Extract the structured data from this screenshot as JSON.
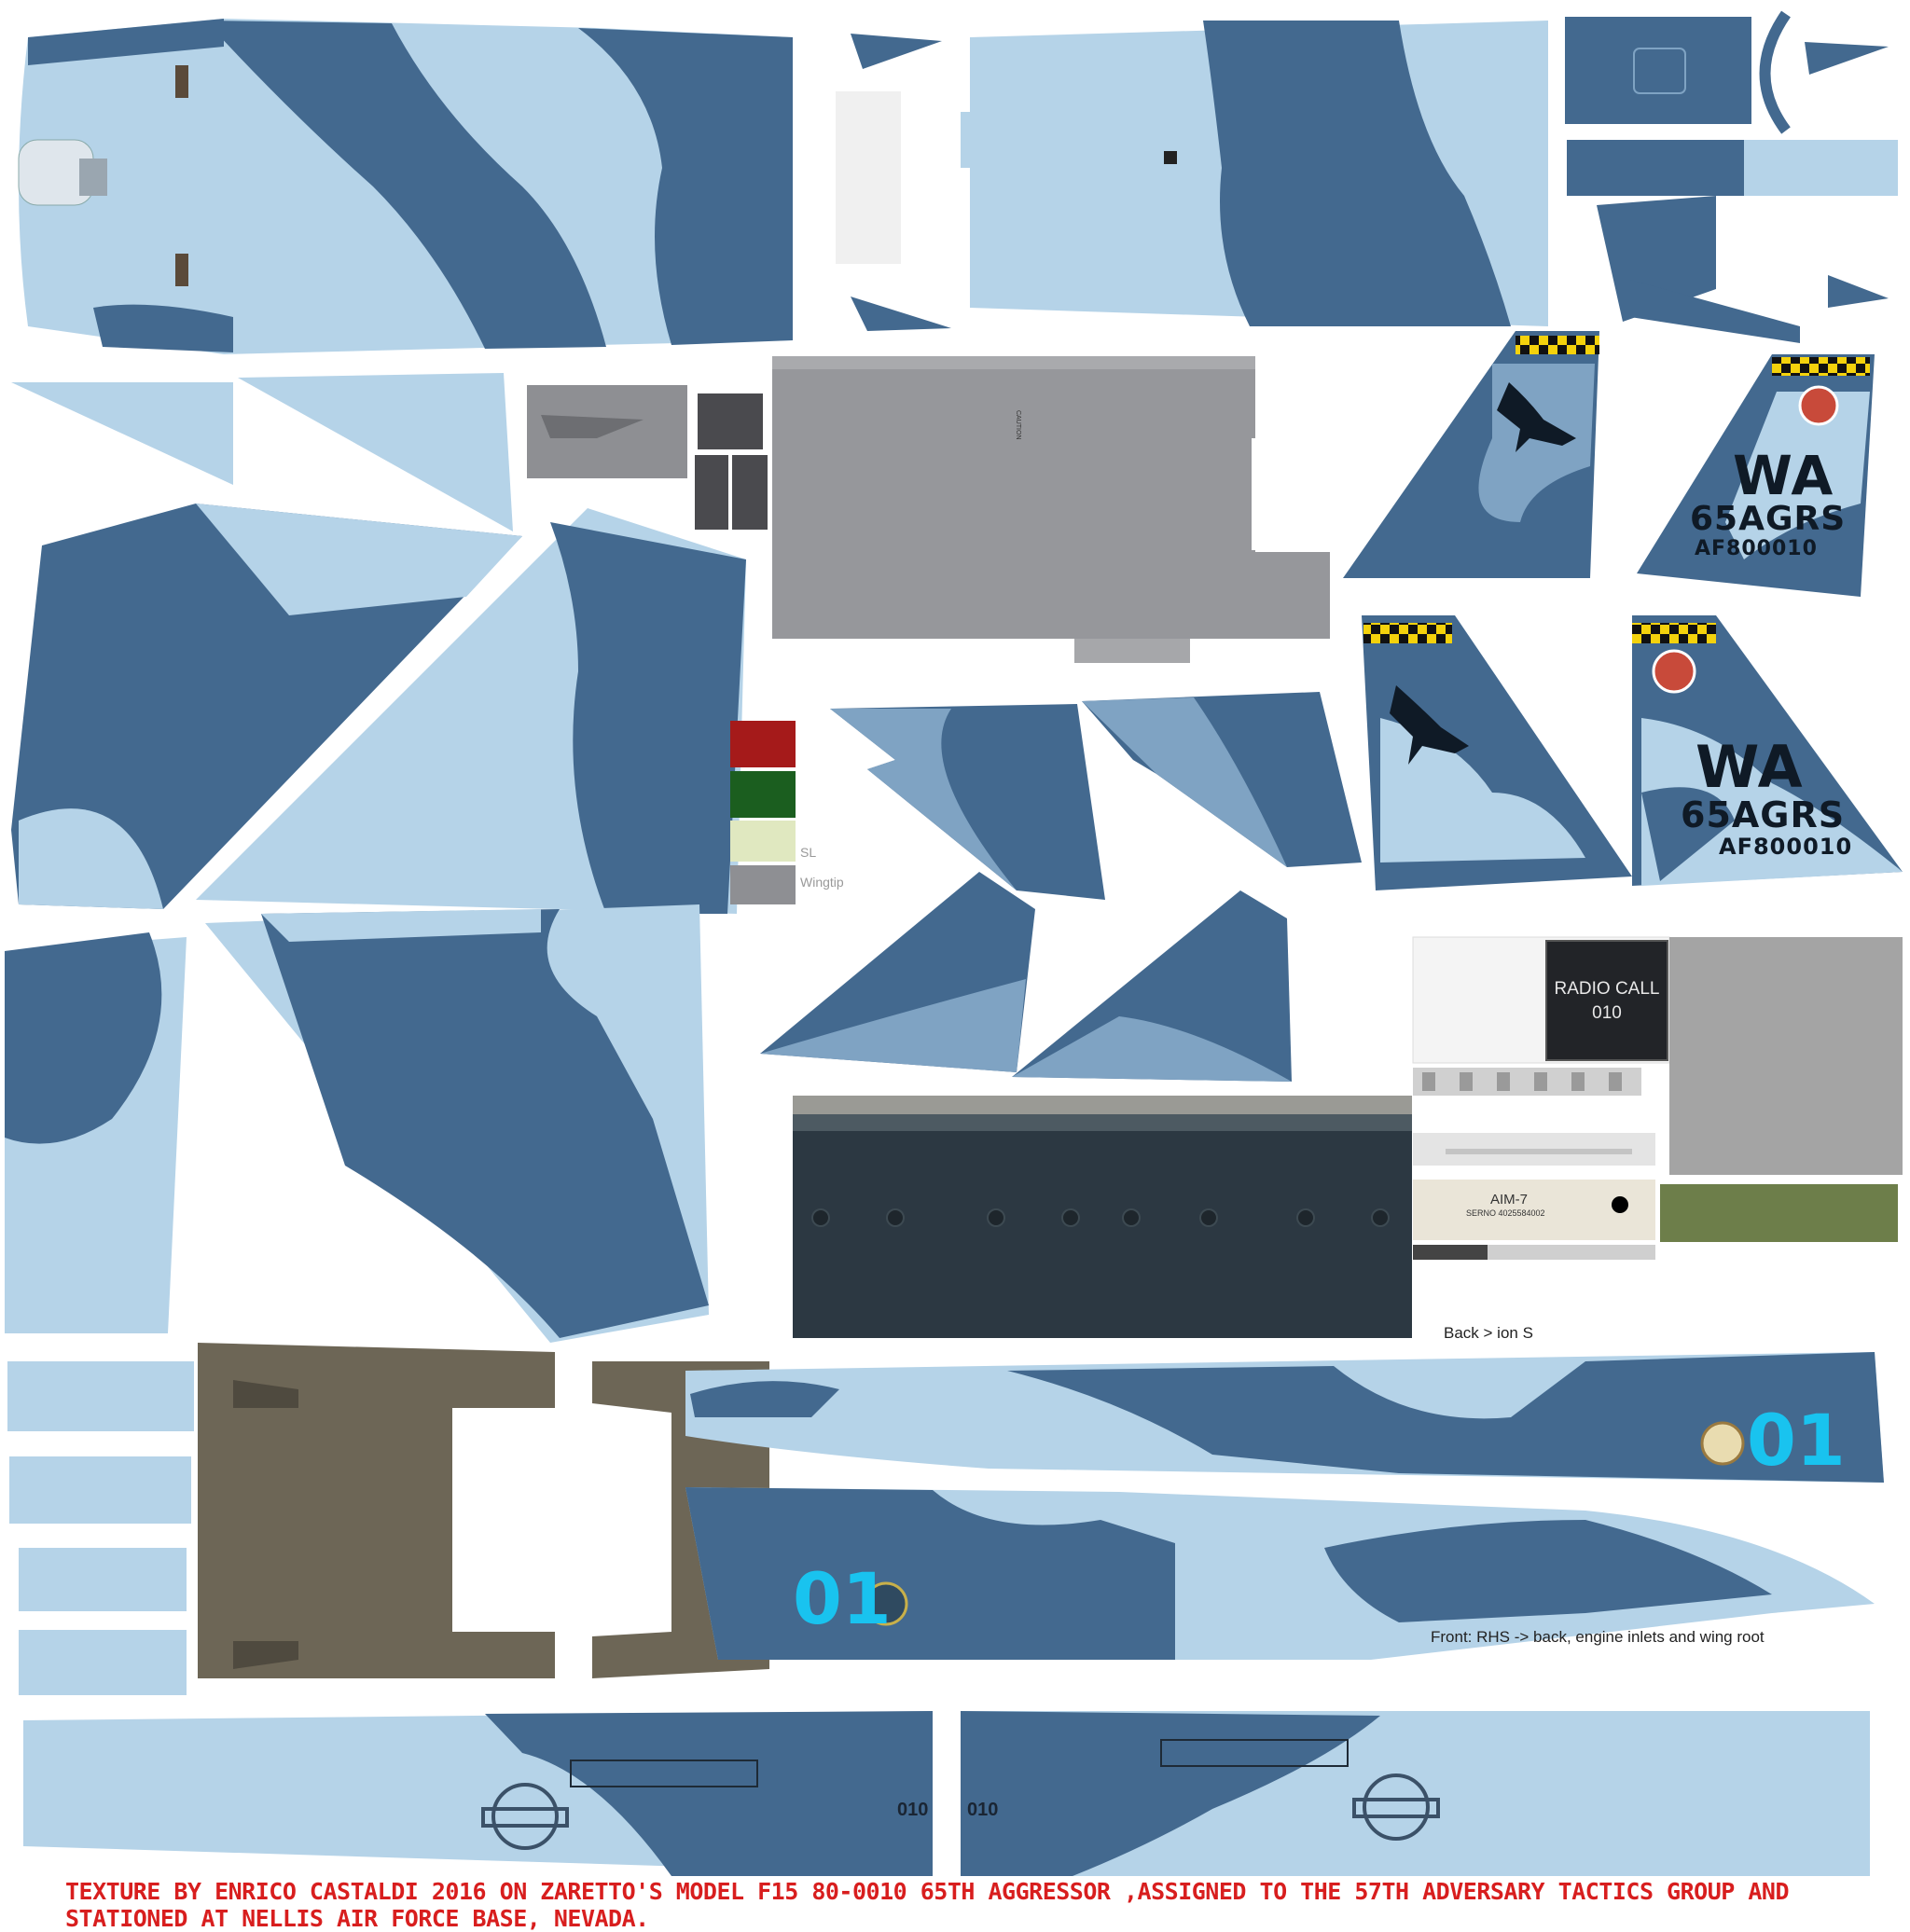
{
  "colors": {
    "camo_light": "#b5d3e8",
    "camo_dark": "#43698f",
    "camo_mid": "#7fa3c3",
    "primer_gray": "#96979b",
    "hot_metal": "#6d6656",
    "panel_dark": "#2c3842",
    "credit_red": "#d81e1e",
    "id_blue": "#19c3ef",
    "checker_yellow": "#f4d20c"
  },
  "tails": [
    {
      "code": "WA",
      "squadron": "65AGRS",
      "serial": "AF800010"
    },
    {
      "code": "WA",
      "squadron": "65AGRS",
      "serial": "AF800010"
    }
  ],
  "fuselage": {
    "nose_number_right": "01",
    "nose_number_left": "01"
  },
  "radio_call": {
    "label": "RADIO CALL",
    "number": "010"
  },
  "missile": {
    "name": "AIM-7",
    "serial": "SERNO 4025584002"
  },
  "swatch_labels": {
    "sl": "SL",
    "wingtip": "Wingtip"
  },
  "notes": {
    "back_label": "Back  >  ion    S",
    "front_label": "Front: RHS -> back, engine inlets and wing root"
  },
  "wing_numbers": {
    "left": "010",
    "right": "010"
  },
  "caution_text": "CAUTION",
  "credit": "TEXTURE BY ENRICO CASTALDI 2016 ON ZARETTO'S MODEL    F15 80-0010 65TH AGGRESSOR ,ASSIGNED TO THE 57TH ADVERSARY TACTICS GROUP AND STATIONED AT NELLIS AIR FORCE BASE, NEVADA."
}
